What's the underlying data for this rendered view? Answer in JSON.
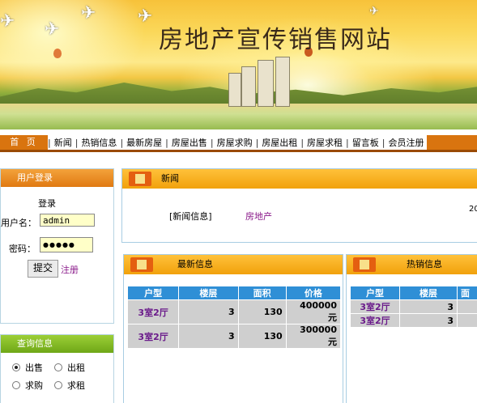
{
  "site_title": "房地产宣传销售网站",
  "nav": {
    "home": "首 页",
    "items": [
      "新闻",
      "热销信息",
      "最新房屋",
      "房屋出售",
      "房屋求购",
      "房屋出租",
      "房屋求租",
      "留言板",
      "会员注册"
    ]
  },
  "login": {
    "header": "用户登录",
    "title": "登录",
    "username_label": "用户名：",
    "username_value": "admin",
    "password_label": "密码：",
    "password_mask": "●●●●●",
    "submit_label": "提交",
    "register_label": "注册"
  },
  "query": {
    "header": "查询信息",
    "options": [
      "出售",
      "出租",
      "求购",
      "求租"
    ],
    "selected": "出售"
  },
  "news": {
    "header": "新闻",
    "item_tag": "[新闻信息]",
    "item_title": "房地产",
    "item_date_partial": "20"
  },
  "latest": {
    "header": "最新信息",
    "columns": [
      "户型",
      "楼层",
      "面积",
      "价格"
    ],
    "rows": [
      {
        "type": "3室2厅",
        "floor": "3",
        "area": "130",
        "price": "400000 元"
      },
      {
        "type": "3室2厅",
        "floor": "3",
        "area": "130",
        "price": "300000 元"
      }
    ]
  },
  "hot": {
    "header": "热销信息",
    "columns": [
      "户型",
      "楼层",
      "面"
    ],
    "rows": [
      {
        "type": "3室2厅",
        "floor": "3"
      },
      {
        "type": "3室2厅",
        "floor": "3"
      }
    ]
  },
  "colors": {
    "nav_orange": "#d9740f",
    "header_blue": "#2f8fd6",
    "link_purple": "#8a1a8a"
  }
}
